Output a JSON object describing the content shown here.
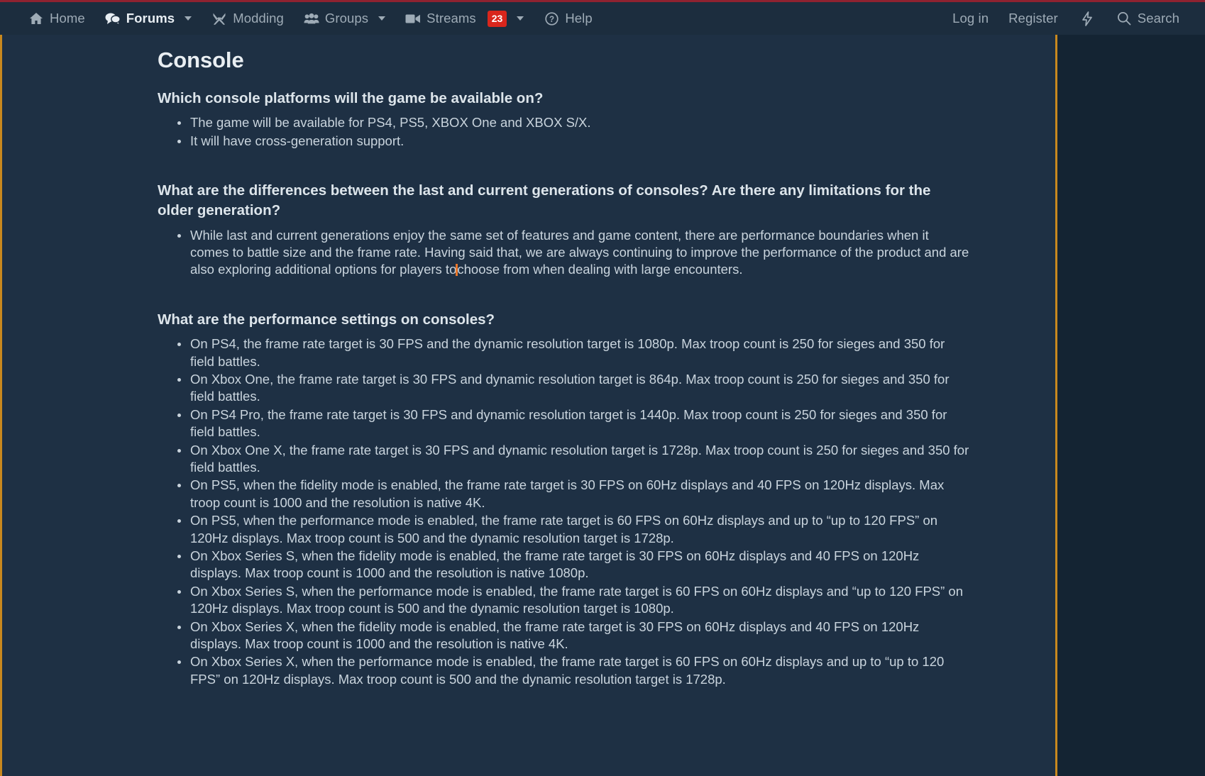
{
  "navbar": {
    "left_items": [
      {
        "label": "Home",
        "icon": "home-icon",
        "active": false,
        "caret": false,
        "badge": null
      },
      {
        "label": "Forums",
        "icon": "comment-icon",
        "active": true,
        "caret": true,
        "badge": null
      },
      {
        "label": "Modding",
        "icon": "tools-icon",
        "active": false,
        "caret": false,
        "badge": null
      },
      {
        "label": "Groups",
        "icon": "users-icon",
        "active": false,
        "caret": true,
        "badge": null
      },
      {
        "label": "Streams",
        "icon": "video-icon",
        "active": false,
        "caret": true,
        "badge": "23"
      },
      {
        "label": "Help",
        "icon": "question-circle-icon",
        "active": false,
        "caret": false,
        "badge": null
      }
    ],
    "right_items": [
      {
        "label": "Log in",
        "icon": null
      },
      {
        "label": "Register",
        "icon": null
      },
      {
        "label": "",
        "icon": "bolt-icon"
      },
      {
        "label": "Search",
        "icon": "search-icon"
      }
    ],
    "colors": {
      "top_border": "#8f2230",
      "background": "#1c2d3e",
      "badge": "#d9261c",
      "text": "#9eabb6",
      "text_active": "#e8eef3"
    }
  },
  "page": {
    "title": "Console",
    "accent_rule": "#c8881e",
    "background": "#1e3044",
    "outer_background": "#142433",
    "caret_color": "#e8762a"
  },
  "sections": [
    {
      "question": "Which console platforms will the game be available on?",
      "answers": [
        "The game will be available for PS4, PS5, XBOX One and XBOX S/X.",
        "It will have cross-generation support."
      ]
    },
    {
      "question": "What are the differences between the last and current generations of consoles? Are there any limitations for the older generation?",
      "answers_split": [
        {
          "before": "While last and current generations enjoy the same set of features and game content, there are performance boundaries when it comes to battle size and the frame rate. Having said that, we are always continuing to improve the performance of the product and are also exploring additional options for players to",
          "caret": true,
          "after": "choose from when dealing with large encounters."
        }
      ]
    },
    {
      "question": "What are the performance settings on consoles?",
      "answers": [
        "On PS4, the frame rate target is 30 FPS and the dynamic resolution target is 1080p. Max troop count is 250 for sieges and 350 for field battles.",
        "On Xbox One, the frame rate target is 30 FPS and dynamic resolution target is 864p. Max troop count is 250 for sieges and 350 for field battles.",
        "On PS4 Pro, the frame rate target is 30 FPS and dynamic resolution target is 1440p. Max troop count is 250 for sieges and 350 for field battles.",
        "On Xbox One X, the frame rate target is 30 FPS and dynamic resolution target is 1728p. Max troop count is 250 for sieges and 350 for field battles.",
        "On PS5, when the fidelity mode is enabled, the frame rate target is 30 FPS on 60Hz displays and 40 FPS on 120Hz displays. Max troop count is 1000 and the resolution is native 4K.",
        "On PS5, when the performance mode is enabled, the frame rate target is 60 FPS on 60Hz displays and up to “up to 120 FPS” on 120Hz displays. Max troop count is 500 and the dynamic resolution target is 1728p.",
        "On Xbox Series S, when the fidelity mode is enabled, the frame rate target is 30 FPS on 60Hz displays and 40 FPS on 120Hz displays. Max troop count is 1000 and the resolution is native 1080p.",
        "On Xbox Series S, when the performance mode is enabled, the frame rate target is 60 FPS on 60Hz displays and “up to 120 FPS” on 120Hz displays. Max troop count is 500 and the dynamic resolution target is 1080p.",
        "On Xbox Series X, when the fidelity mode is enabled, the frame rate target is 30 FPS on 60Hz displays and 40 FPS on 120Hz displays. Max troop count is 1000 and the resolution is native 4K.",
        "On Xbox Series X, when the performance mode is enabled, the frame rate target is 60 FPS on 60Hz displays and up to “up to 120 FPS” on 120Hz displays. Max troop count is 500 and the dynamic resolution target is 1728p."
      ]
    }
  ]
}
